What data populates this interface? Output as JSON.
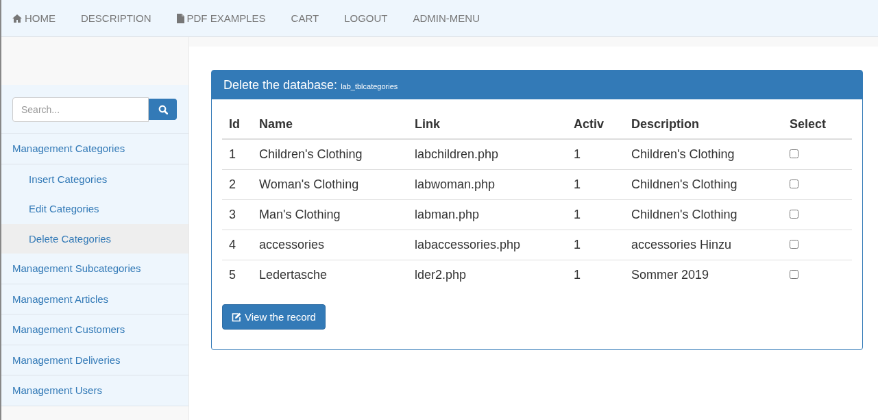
{
  "nav": [
    {
      "label": "HOME",
      "kind": "home"
    },
    {
      "label": "DESCRIPTION",
      "kind": "plain"
    },
    {
      "label": "PDF EXAMPLES",
      "kind": "document"
    },
    {
      "label": "CART",
      "kind": "plain"
    },
    {
      "label": "LOGOUT",
      "kind": "plain"
    },
    {
      "label": "ADMIN-MENU",
      "kind": "plain"
    }
  ],
  "search": {
    "placeholder": "Search..."
  },
  "sidebar": {
    "items": [
      {
        "label": "Management Categories",
        "selected": false,
        "children": [
          {
            "label": "Insert Categories",
            "selected": false
          },
          {
            "label": "Edit Categories",
            "selected": false
          },
          {
            "label": "Delete Categories",
            "selected": true
          }
        ]
      },
      {
        "label": "Management Subcategories",
        "selected": false
      },
      {
        "label": "Management Articles",
        "selected": false
      },
      {
        "label": "Management Customers",
        "selected": false
      },
      {
        "label": "Management Deliveries",
        "selected": false
      },
      {
        "label": "Management Users",
        "selected": false
      }
    ]
  },
  "panel": {
    "title": "Delete the database:",
    "table_name": "lab_tblcategories",
    "table": {
      "columns": [
        "Id",
        "Name",
        "Link",
        "Activ",
        "Description",
        "Select"
      ],
      "rows": [
        {
          "cells": [
            "1",
            "Children's Clothing",
            "labchildren.php",
            "1",
            "Children's Clothing"
          ],
          "checked": false
        },
        {
          "cells": [
            "2",
            "Woman's Clothing",
            "labwoman.php",
            "1",
            "Childnen's Clothing"
          ],
          "checked": false
        },
        {
          "cells": [
            "3",
            "Man's Clothing",
            "labman.php",
            "1",
            "Childnen's Clothing"
          ],
          "checked": false
        },
        {
          "cells": [
            "4",
            "accessories",
            "labaccessories.php",
            "1",
            "accessories Hinzu"
          ],
          "checked": false
        },
        {
          "cells": [
            "5",
            "Ledertasche",
            "lder2.php",
            "1",
            "Sommer 2019"
          ],
          "checked": false
        }
      ]
    },
    "button": "View the record"
  }
}
